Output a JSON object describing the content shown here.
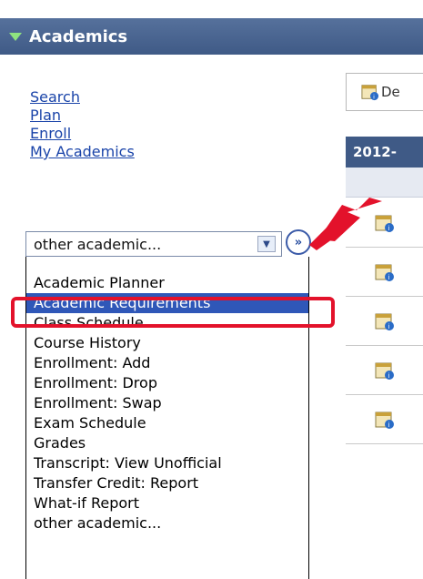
{
  "header": {
    "title": "Academics"
  },
  "nav_links": [
    "Search",
    "Plan",
    "Enroll",
    "My Academics"
  ],
  "select": {
    "value": "other academic..."
  },
  "dropdown": {
    "options": [
      "",
      "Academic Planner",
      "Academic Requirements",
      "Class Schedule",
      "Course History",
      "Enrollment: Add",
      "Enrollment: Drop",
      "Enrollment: Swap",
      "Exam Schedule",
      "Grades",
      "Transcript: View Unofficial",
      "Transfer Credit: Report",
      "What-if Report",
      "other academic..."
    ],
    "selected_index": 2
  },
  "right_panel": {
    "toolbar_text": "De",
    "term_header": "2012-"
  },
  "colors": {
    "header_bg": "#4a6690",
    "highlight": "#e3122b",
    "selected_bg": "#2f57b8"
  }
}
